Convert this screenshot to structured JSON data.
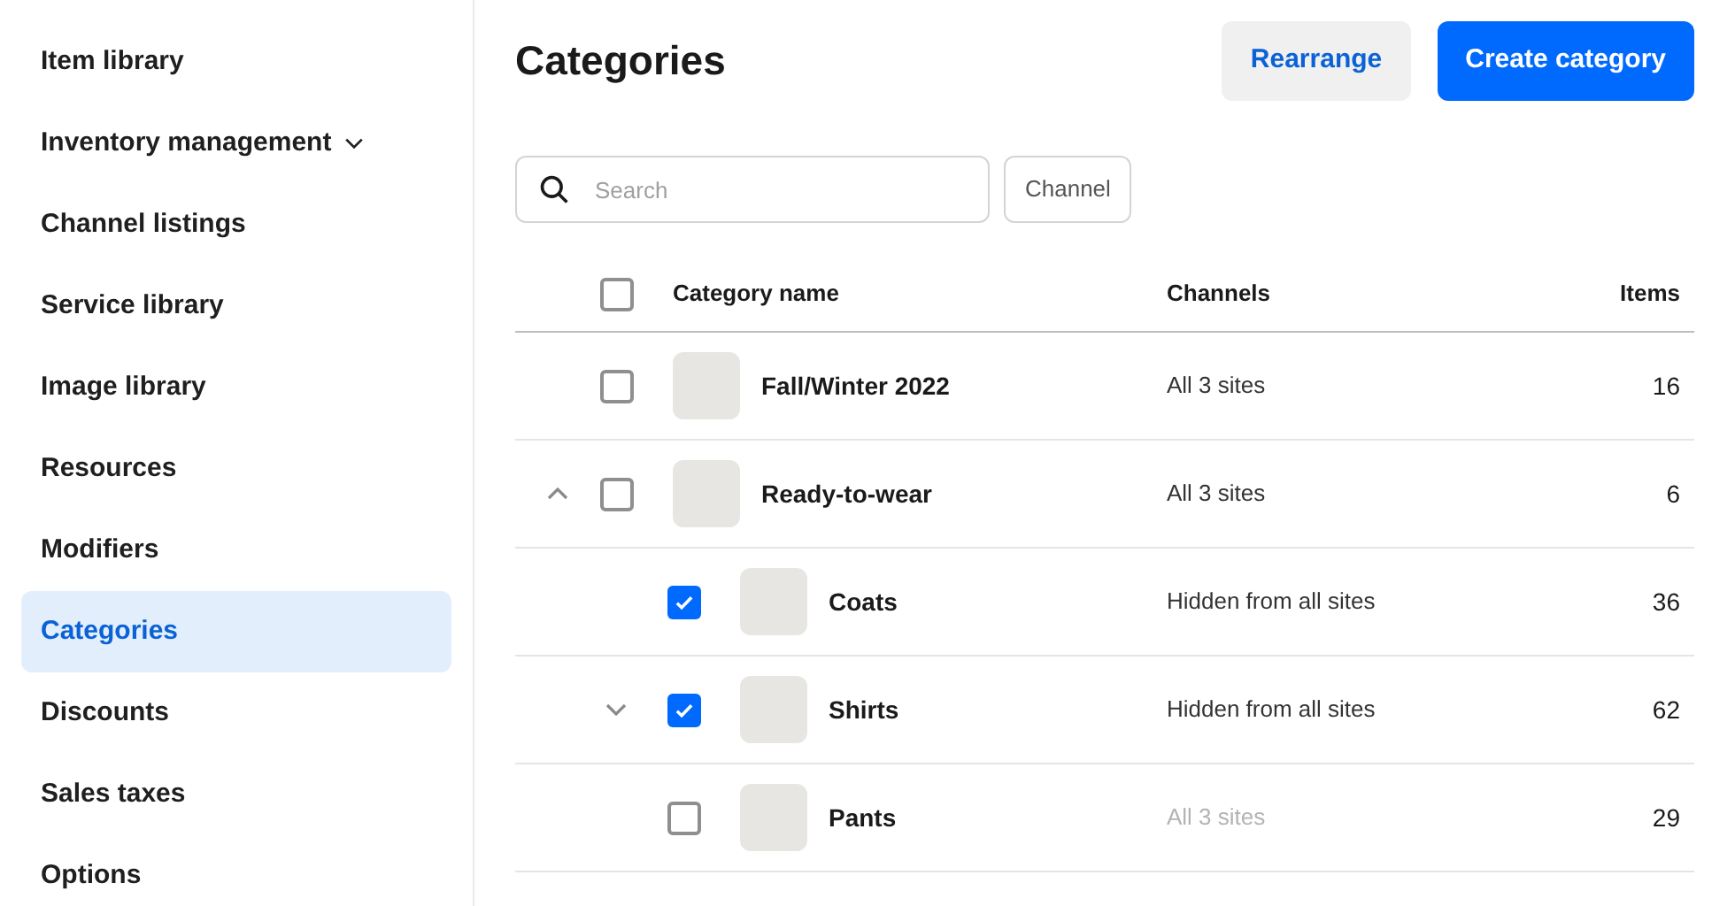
{
  "sidebar": {
    "items": [
      {
        "label": "Item library",
        "selected": false
      },
      {
        "label": "Inventory management",
        "selected": false,
        "expanded": false
      },
      {
        "label": "Channel listings",
        "selected": false
      },
      {
        "label": "Service library",
        "selected": false
      },
      {
        "label": "Image library",
        "selected": false
      },
      {
        "label": "Resources",
        "selected": false
      },
      {
        "label": "Modifiers",
        "selected": false
      },
      {
        "label": "Categories",
        "selected": true
      },
      {
        "label": "Discounts",
        "selected": false
      },
      {
        "label": "Sales taxes",
        "selected": false
      },
      {
        "label": "Options",
        "selected": false
      }
    ]
  },
  "header": {
    "title": "Categories",
    "buttons": [
      {
        "label": "Rearrange",
        "kind": "secondary"
      },
      {
        "label": "Create category",
        "kind": "primary"
      }
    ]
  },
  "filters": {
    "search": {
      "placeholder": "Search"
    },
    "channel_button": "Channel"
  },
  "table": {
    "select_all": {
      "checked": false
    },
    "columns": [
      "Category name",
      "Channels",
      "Items"
    ],
    "rows": [
      {
        "name": "Fall/Winter 2022",
        "channels": "All 3 sites",
        "items": "16",
        "checked": false,
        "dimmed": false
      },
      {
        "name": "Ready-to-wear",
        "channels": "All 3 sites",
        "items": "6",
        "checked": false,
        "dimmed": false,
        "expanded": true,
        "children": [
          {
            "name": "Coats",
            "channels": "Hidden from all sites",
            "items": "36",
            "checked": true,
            "dimmed": false
          },
          {
            "name": "Shirts",
            "channels": "Hidden from all sites",
            "items": "62",
            "checked": true,
            "dimmed": false,
            "expanded": false
          },
          {
            "name": "Pants",
            "channels": "All 3 sites",
            "items": "29",
            "checked": false,
            "dimmed": true
          }
        ]
      }
    ]
  }
}
